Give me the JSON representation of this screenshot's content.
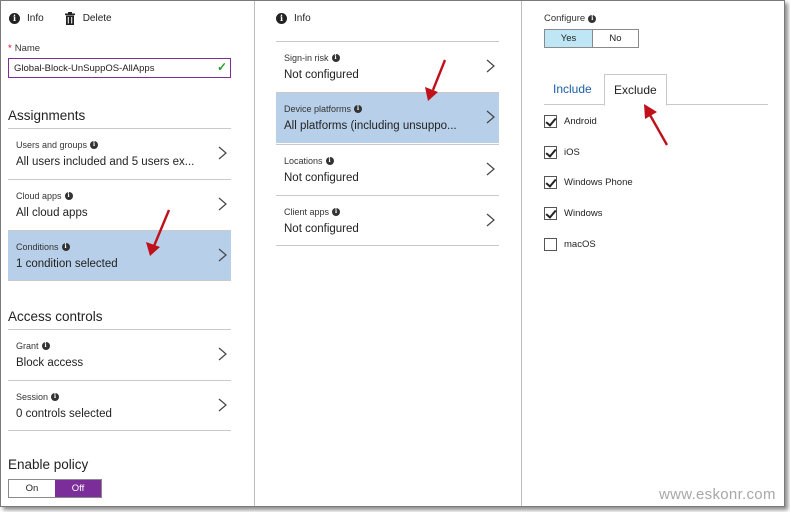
{
  "blade1": {
    "toolbar": {
      "info_label": "Info",
      "delete_label": "Delete"
    },
    "name_label": "Name",
    "name_required_marker": "*",
    "name_value": "Global-Block-UnSuppOS-AllApps",
    "assignments_heading": "Assignments",
    "assignments": [
      {
        "title": "Users and groups",
        "value": "All users included and 5 users ex..."
      },
      {
        "title": "Cloud apps",
        "value": "All cloud apps"
      },
      {
        "title": "Conditions",
        "value": "1 condition selected"
      }
    ],
    "access_heading": "Access controls",
    "access": [
      {
        "title": "Grant",
        "value": "Block access"
      },
      {
        "title": "Session",
        "value": "0 controls selected"
      }
    ],
    "enable_heading": "Enable policy",
    "enable_options": [
      "On",
      "Off"
    ],
    "enable_selected": "Off"
  },
  "blade2": {
    "toolbar": {
      "info_label": "Info"
    },
    "conditions": [
      {
        "title": "Sign-in risk",
        "value": "Not configured"
      },
      {
        "title": "Device platforms",
        "value": "All platforms (including unsuppo..."
      },
      {
        "title": "Locations",
        "value": "Not configured"
      },
      {
        "title": "Client apps",
        "value": "Not configured"
      }
    ]
  },
  "blade3": {
    "configure_label": "Configure",
    "configure_options": [
      "Yes",
      "No"
    ],
    "configure_selected": "Yes",
    "tabs": [
      "Include",
      "Exclude"
    ],
    "active_tab": "Exclude",
    "platforms": [
      {
        "label": "Android",
        "checked": true
      },
      {
        "label": "iOS",
        "checked": true
      },
      {
        "label": "Windows Phone",
        "checked": true
      },
      {
        "label": "Windows",
        "checked": true
      },
      {
        "label": "macOS",
        "checked": false
      }
    ]
  },
  "watermark": "www.eskonr.com",
  "colors": {
    "selected_row": "#b7cfe8",
    "toggle_purple": "#7b2e9a",
    "yes_blue": "#bfe6f5",
    "annotation_red": "#c0101a"
  }
}
